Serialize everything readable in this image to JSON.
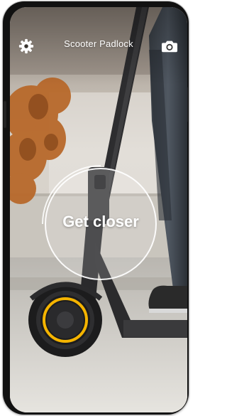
{
  "header": {
    "title": "Scooter Padlock",
    "settings_icon": "gear-icon",
    "camera_icon": "camera-icon"
  },
  "scanner": {
    "status_text": "Get closer"
  },
  "colors": {
    "overlay_text": "#ffffff",
    "wheel_accent": "#f5b400",
    "phone_frame": "#111111"
  }
}
